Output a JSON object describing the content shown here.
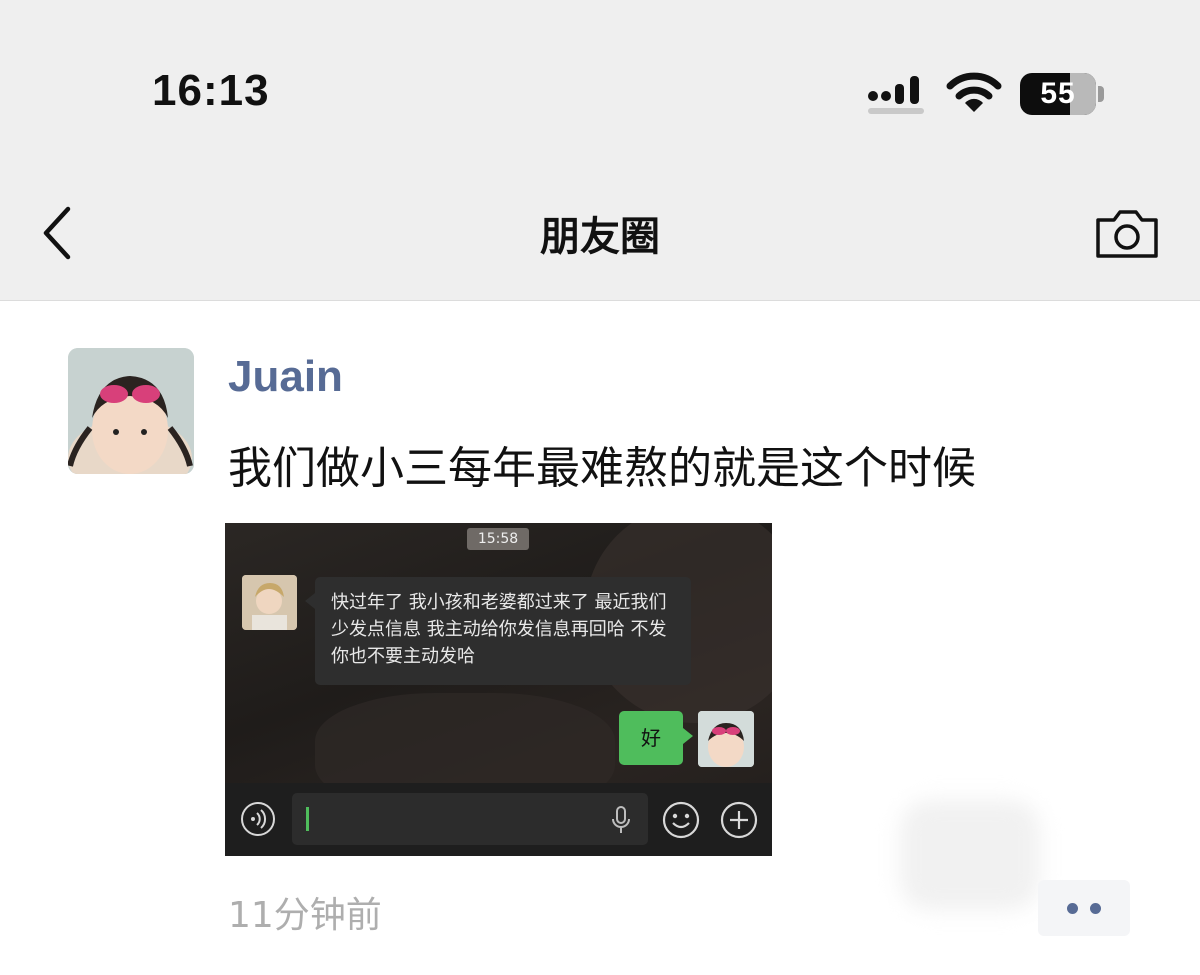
{
  "status_bar": {
    "time": "16:13",
    "battery": "55",
    "icons": [
      "signal-icon",
      "wifi-icon",
      "battery-icon"
    ]
  },
  "nav": {
    "title": "朋友圈",
    "back_icon": "chevron-left-icon",
    "camera_icon": "camera-icon"
  },
  "post": {
    "username": "Juain",
    "text": "我们做小三每年最难熬的就是这个时候",
    "timestamp": "11分钟前",
    "more_icon": "more-dots-icon",
    "accent_color": "#576b95",
    "image": {
      "chat_time": "15:58",
      "incoming_message": "快过年了 我小孩和老婆都过来了 最近我们少发点信息 我主动给你发信息再回哈 不发你也不要主动发哈",
      "outgoing_message": "好",
      "outgoing_bubble_color": "#4fbd5c",
      "input_icons": [
        "voice-icon",
        "microphone-icon",
        "emoji-icon",
        "plus-icon"
      ]
    }
  }
}
